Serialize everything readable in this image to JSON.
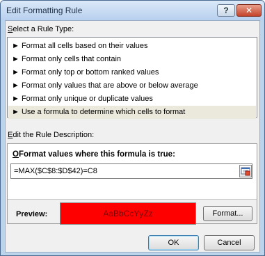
{
  "window": {
    "title": "Edit Formatting Rule",
    "help_label": "?",
    "close_label": "✕"
  },
  "rule_type": {
    "label_prefix": "S",
    "label_rest": "elect a Rule Type:",
    "items": [
      {
        "text": "► Format all cells based on their values",
        "selected": false
      },
      {
        "text": "► Format only cells that contain",
        "selected": false
      },
      {
        "text": "► Format only top or bottom ranked values",
        "selected": false
      },
      {
        "text": "► Format only values that are above or below average",
        "selected": false
      },
      {
        "text": "► Format only unique or duplicate values",
        "selected": false
      },
      {
        "text": "► Use a formula to determine which cells to format",
        "selected": true
      }
    ]
  },
  "description": {
    "label_prefix": "E",
    "label_rest": "dit the Rule Description:",
    "formula_label_prefix": "O",
    "formula_label_rest": "Format values where this formula is true:",
    "formula_value": "=MAX($C$8:$D$42)=C8",
    "ref_icon": "collapse-dialog-icon",
    "preview_label": "Preview:",
    "preview_text": "AaBbCcYyZz",
    "preview_fill": "#ff0000",
    "format_button": "Format..."
  },
  "buttons": {
    "ok": "OK",
    "cancel": "Cancel"
  }
}
